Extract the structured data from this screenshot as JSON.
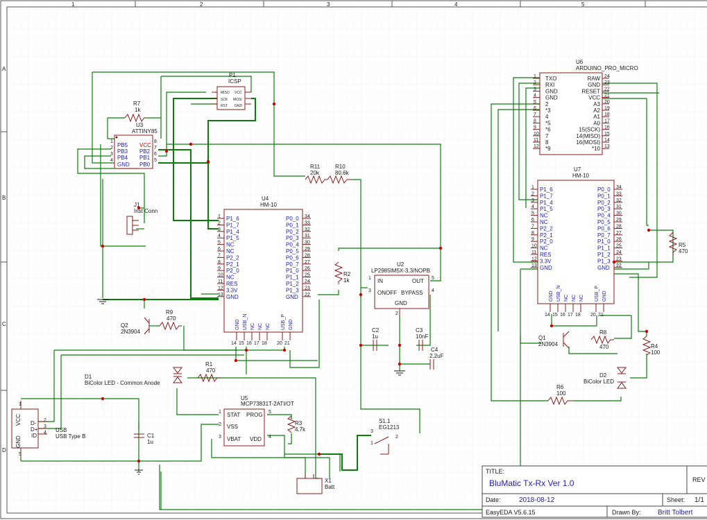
{
  "border": {
    "cols": [
      "1",
      "2",
      "3",
      "4",
      "5"
    ],
    "rows": [
      "A",
      "B",
      "C",
      "D"
    ]
  },
  "title_block": {
    "title_label": "TITLE:",
    "title": "BluMatic Tx-Rx Ver 1.0",
    "rev_label": "REV",
    "date_label": "Date:",
    "date": "2018-08-12",
    "sheet_label": "Sheet:",
    "sheet": "1/1",
    "tool": "EasyEDA V5.6.15",
    "drawn_label": "Drawn By:",
    "drawn_by": "Britt Tolbert"
  },
  "components": {
    "p1": {
      "ref": "P1",
      "name": "ICSP",
      "pins": [
        "MISO",
        "VCC",
        "SCK",
        "MOSI",
        "RST",
        "GND"
      ]
    },
    "r7": {
      "ref": "R7",
      "value": "1k"
    },
    "u3": {
      "ref": "U3",
      "name": "ATTINY85",
      "left_pins": [
        "PB5",
        "PB3",
        "PB4",
        "GND"
      ],
      "right_pins": [
        "VCC",
        "PB2",
        "PB1",
        "PB0"
      ],
      "left_nums": [
        "1",
        "2",
        "3",
        "4"
      ],
      "right_nums": [
        "8",
        "7",
        "6",
        "5"
      ]
    },
    "j1": {
      "ref": "J1",
      "name": "Inst Conn"
    },
    "r11": {
      "ref": "R11",
      "value": "20k"
    },
    "r10": {
      "ref": "R10",
      "value": "80.6k"
    },
    "u4": {
      "ref": "U4",
      "name": "HM-10",
      "left_pins": [
        "P1_6",
        "P1_7",
        "P1_4",
        "P1_5",
        "NC",
        "NC",
        "P2_2",
        "P2_1",
        "P2_0",
        "NC",
        "RES",
        "3.3V",
        "GND"
      ],
      "left_nums": [
        "1",
        "2",
        "3",
        "4",
        "5",
        "6",
        "7",
        "8",
        "9",
        "10",
        "11",
        "12",
        "13"
      ],
      "right_pins": [
        "P0_0",
        "P0_1",
        "P0_2",
        "P0_3",
        "P0_4",
        "P0_5",
        "P0_6",
        "P0_7",
        "P1_0",
        "P1_1",
        "P1_2",
        "P1_3",
        "GND"
      ],
      "right_nums": [
        "34",
        "33",
        "32",
        "31",
        "30",
        "29",
        "28",
        "27",
        "26",
        "25",
        "24",
        "23",
        "22"
      ],
      "bottom_pins": [
        "GND",
        "USB_N",
        "NC",
        "NC",
        "NC",
        "USB_P",
        "GND"
      ],
      "bottom_nums": [
        "14",
        "15",
        "16",
        "17",
        "18",
        "20",
        "21"
      ]
    },
    "r2": {
      "ref": "R2",
      "value": "1k"
    },
    "u2": {
      "ref": "U2",
      "name": "LP2985IM5X-3.3/NOPB",
      "pins": [
        "IN",
        "OUT",
        "ONOFF",
        "BYPASS",
        "GND"
      ],
      "nums": [
        "1",
        "5",
        "3",
        "4",
        "2"
      ]
    },
    "q2": {
      "ref": "Q2",
      "name": "2N3904"
    },
    "r9": {
      "ref": "R9",
      "value": "470"
    },
    "c2": {
      "ref": "C2",
      "value": "1u"
    },
    "c3": {
      "ref": "C3",
      "value": "10nF"
    },
    "c4": {
      "ref": "C4",
      "value": "2.2uF"
    },
    "d1": {
      "ref": "D1",
      "name": "BiColor LED - Common Anode"
    },
    "r1": {
      "ref": "R1",
      "value": "470"
    },
    "u5": {
      "ref": "U5",
      "name": "MCP73831T-2ATI/OT",
      "pins": [
        "STAT",
        "PROG",
        "VSS",
        "VBAT",
        "VDD"
      ],
      "nums": [
        "1",
        "5",
        "2",
        "3",
        "4"
      ]
    },
    "r3": {
      "ref": "R3",
      "value": "4.7k"
    },
    "usb": {
      "pins": [
        "VCC",
        "D-",
        "D+",
        "ID",
        "GND"
      ],
      "nums": [
        "1",
        "2",
        "3",
        "4",
        "5"
      ],
      "label1": "USB",
      "label2": "USB Type B"
    },
    "c1": {
      "ref": "C1",
      "value": "1u"
    },
    "s1": {
      "ref": "S1.1",
      "name": "EG1213",
      "nums": [
        "3",
        "1",
        "2"
      ]
    },
    "x1": {
      "ref": "X1",
      "name": "Batt"
    },
    "u6": {
      "ref": "U6",
      "name": "ARDUINO_PRO_MICRO",
      "left_pins": [
        "TXO",
        "RXI",
        "GND",
        "GND",
        "2",
        "*3",
        "4",
        "*5",
        "*6",
        "7",
        "8",
        "*9"
      ],
      "left_nums": [
        "1",
        "2",
        "3",
        "4",
        "5",
        "6",
        "7",
        "8",
        "9",
        "10",
        "11",
        "12"
      ],
      "right_pins": [
        "RAW",
        "GND",
        "RESET",
        "VCC",
        "A3",
        "A2",
        "A1",
        "A0",
        "15(SCK)",
        "14(MISO)",
        "16(MOSI)",
        "*10"
      ],
      "right_nums": [
        "24",
        "23",
        "22",
        "21",
        "20",
        "19",
        "18",
        "17",
        "16",
        "15",
        "14",
        "13"
      ]
    },
    "u7": {
      "ref": "U7",
      "name": "HM-10",
      "left_pins": [
        "P1_6",
        "P1_7",
        "P1_4",
        "P1_5",
        "NC",
        "NC",
        "P2_2",
        "P2_1",
        "P2_0",
        "NC",
        "RES",
        "3.3V",
        "GND"
      ],
      "left_nums": [
        "1",
        "2",
        "3",
        "4",
        "5",
        "6",
        "7",
        "8",
        "9",
        "10",
        "11",
        "12",
        "13"
      ],
      "right_pins": [
        "P0_0",
        "P0_1",
        "P0_2",
        "P0_3",
        "P0_4",
        "P0_5",
        "P0_6",
        "P0_7",
        "P1_0",
        "P1_1",
        "P1_2",
        "P1_3",
        "GND"
      ],
      "right_nums": [
        "34",
        "33",
        "32",
        "31",
        "30",
        "29",
        "28",
        "27",
        "26",
        "25",
        "24",
        "23",
        "22"
      ],
      "bottom_pins": [
        "GND",
        "USB_N",
        "NC",
        "NC",
        "NC",
        "USB_P",
        "GND"
      ],
      "bottom_nums": [
        "14",
        "15",
        "16",
        "17",
        "18",
        "20",
        "21"
      ]
    },
    "r5": {
      "ref": "R5",
      "value": "470"
    },
    "q1": {
      "ref": "Q1",
      "name": "2N3904"
    },
    "r8": {
      "ref": "R8",
      "value": "470"
    },
    "r4": {
      "ref": "R4",
      "value": "100"
    },
    "d2": {
      "ref": "D2",
      "name": "BiColor LED"
    },
    "r6": {
      "ref": "R6",
      "value": "100"
    }
  }
}
